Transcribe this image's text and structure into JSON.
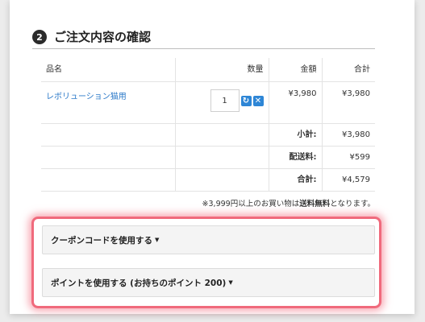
{
  "section": {
    "step_number": "2",
    "title": "ご注文内容の確認"
  },
  "table": {
    "headers": [
      "品名",
      "数量",
      "金額",
      "合計"
    ],
    "item": {
      "name": "レボリューション猫用",
      "quantity": "1",
      "amount": "¥3,980",
      "subtotal": "¥3,980"
    },
    "summary": [
      {
        "label": "小計:",
        "value": "¥3,980"
      },
      {
        "label": "配送料:",
        "value": "¥599"
      },
      {
        "label": "合計:",
        "value": "¥4,579"
      }
    ]
  },
  "free_shipping_note": {
    "prefix": "※3,999円以上のお買い物は",
    "bold": "送料無料",
    "suffix": "となります。"
  },
  "coupon_button": "クーポンコードを使用する",
  "points_button": "ポイントを使用する (お持ちのポイント 200)",
  "icons": {
    "update": "refresh-icon",
    "remove": "close-icon",
    "dropdown": "caret-down-icon"
  },
  "colors": {
    "link": "#2a78c8",
    "icon_button": "#2e86d6",
    "highlight": "#f06a7c"
  }
}
